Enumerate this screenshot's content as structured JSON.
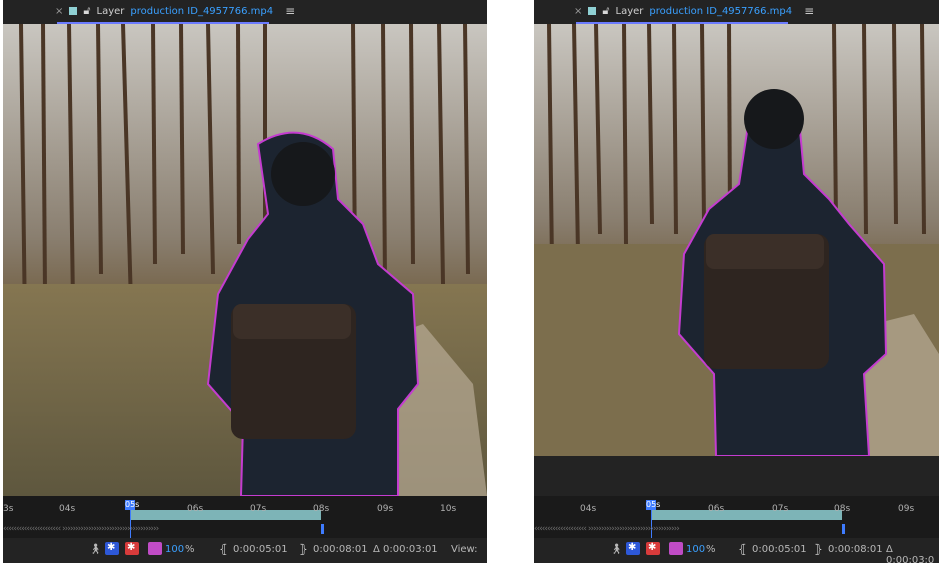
{
  "panels": [
    {
      "tab": {
        "close": "×",
        "label": "Layer",
        "source": "production ID_4957766.mp4",
        "menu": "≡"
      },
      "ruler_labels": [
        "3s",
        "04s",
        "05s",
        "06s",
        "07s",
        "08s",
        "09s",
        "10s"
      ],
      "cti_label": "05s",
      "footer": {
        "zoom": "100",
        "percent": "%",
        "in_point": "0:00:05:01",
        "out_point": "0:00:08:01",
        "duration": "Δ 0:00:03:01",
        "view": "View:"
      }
    },
    {
      "tab": {
        "close": "×",
        "label": "Layer",
        "source": "production ID_4957766.mp4",
        "menu": "≡"
      },
      "ruler_labels": [
        "04s",
        "06s",
        "07s",
        "08s",
        "09s"
      ],
      "cti_label": "05s",
      "footer": {
        "zoom": "100",
        "percent": "%",
        "in_point": "0:00:05:01",
        "out_point": "0:00:08:01",
        "duration": "Δ 0:00:03:0"
      }
    }
  ],
  "colors": {
    "mask_outline": "#c43cd0",
    "work_area": "#8fd0d3",
    "cti": "#3f7cff",
    "source_text": "#3aa0ff"
  },
  "icons": [
    "close-icon",
    "color-swatch-icon",
    "lock-icon",
    "panel-menu-icon",
    "puppet-icon",
    "refine-edge-icon",
    "magenta-swatch-icon",
    "in-bracket-icon",
    "out-bracket-icon"
  ]
}
